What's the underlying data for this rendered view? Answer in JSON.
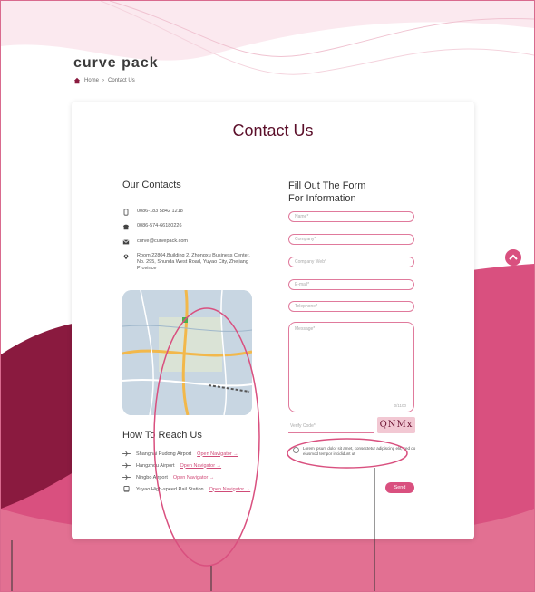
{
  "brand": {
    "logo_text": "curve pack"
  },
  "breadcrumb": {
    "home": "Home",
    "separator": "›",
    "current": "Contact Us"
  },
  "page": {
    "title": "Contact Us"
  },
  "contacts": {
    "heading": "Our Contacts",
    "items": [
      {
        "icon": "phone-icon",
        "text": "0086-183 5842 1218"
      },
      {
        "icon": "telephone-icon",
        "text": "0086-574-66180226"
      },
      {
        "icon": "mail-icon",
        "text": "curve@curvepack.com"
      },
      {
        "icon": "location-pin-icon",
        "text": "Room 22804,Building 2, Zhongxu Business Center, No. 295, Shunda West Road, Yuyao City, Zhejiang Province"
      }
    ]
  },
  "reach": {
    "heading": "How To Reach Us",
    "items": [
      {
        "icon": "plane-icon",
        "text": "Shanghai Pudong Airport",
        "link": "Open Navigator →"
      },
      {
        "icon": "plane-icon",
        "text": "Hangzhou Airport",
        "link": "Open Navigator →"
      },
      {
        "icon": "plane-icon",
        "text": "Ningbo Airport",
        "link": "Open Navigator →"
      },
      {
        "icon": "train-icon",
        "text": "Yuyao High-speed Rail Station",
        "link": "Open Navigator →"
      }
    ]
  },
  "form": {
    "heading_line1": "Fill Out The Form",
    "heading_line2": "For Information",
    "fields": {
      "name": "Name*",
      "company": "Company*",
      "website": "Company Web*",
      "email": "E-mail*",
      "telephone": "Telephone*",
      "message": "Message*"
    },
    "counter": "0/1100",
    "verify_placeholder": "Verify Code*",
    "captcha": "QNMx",
    "agree_text": "Lorem ipsum dolor sit amet, consectetur adipiscing elit, sed do eiusmod tempor incididunt ut",
    "send_label": "Send"
  },
  "colors": {
    "accent": "#d9507f",
    "dark_wine": "#5b0f2a"
  }
}
